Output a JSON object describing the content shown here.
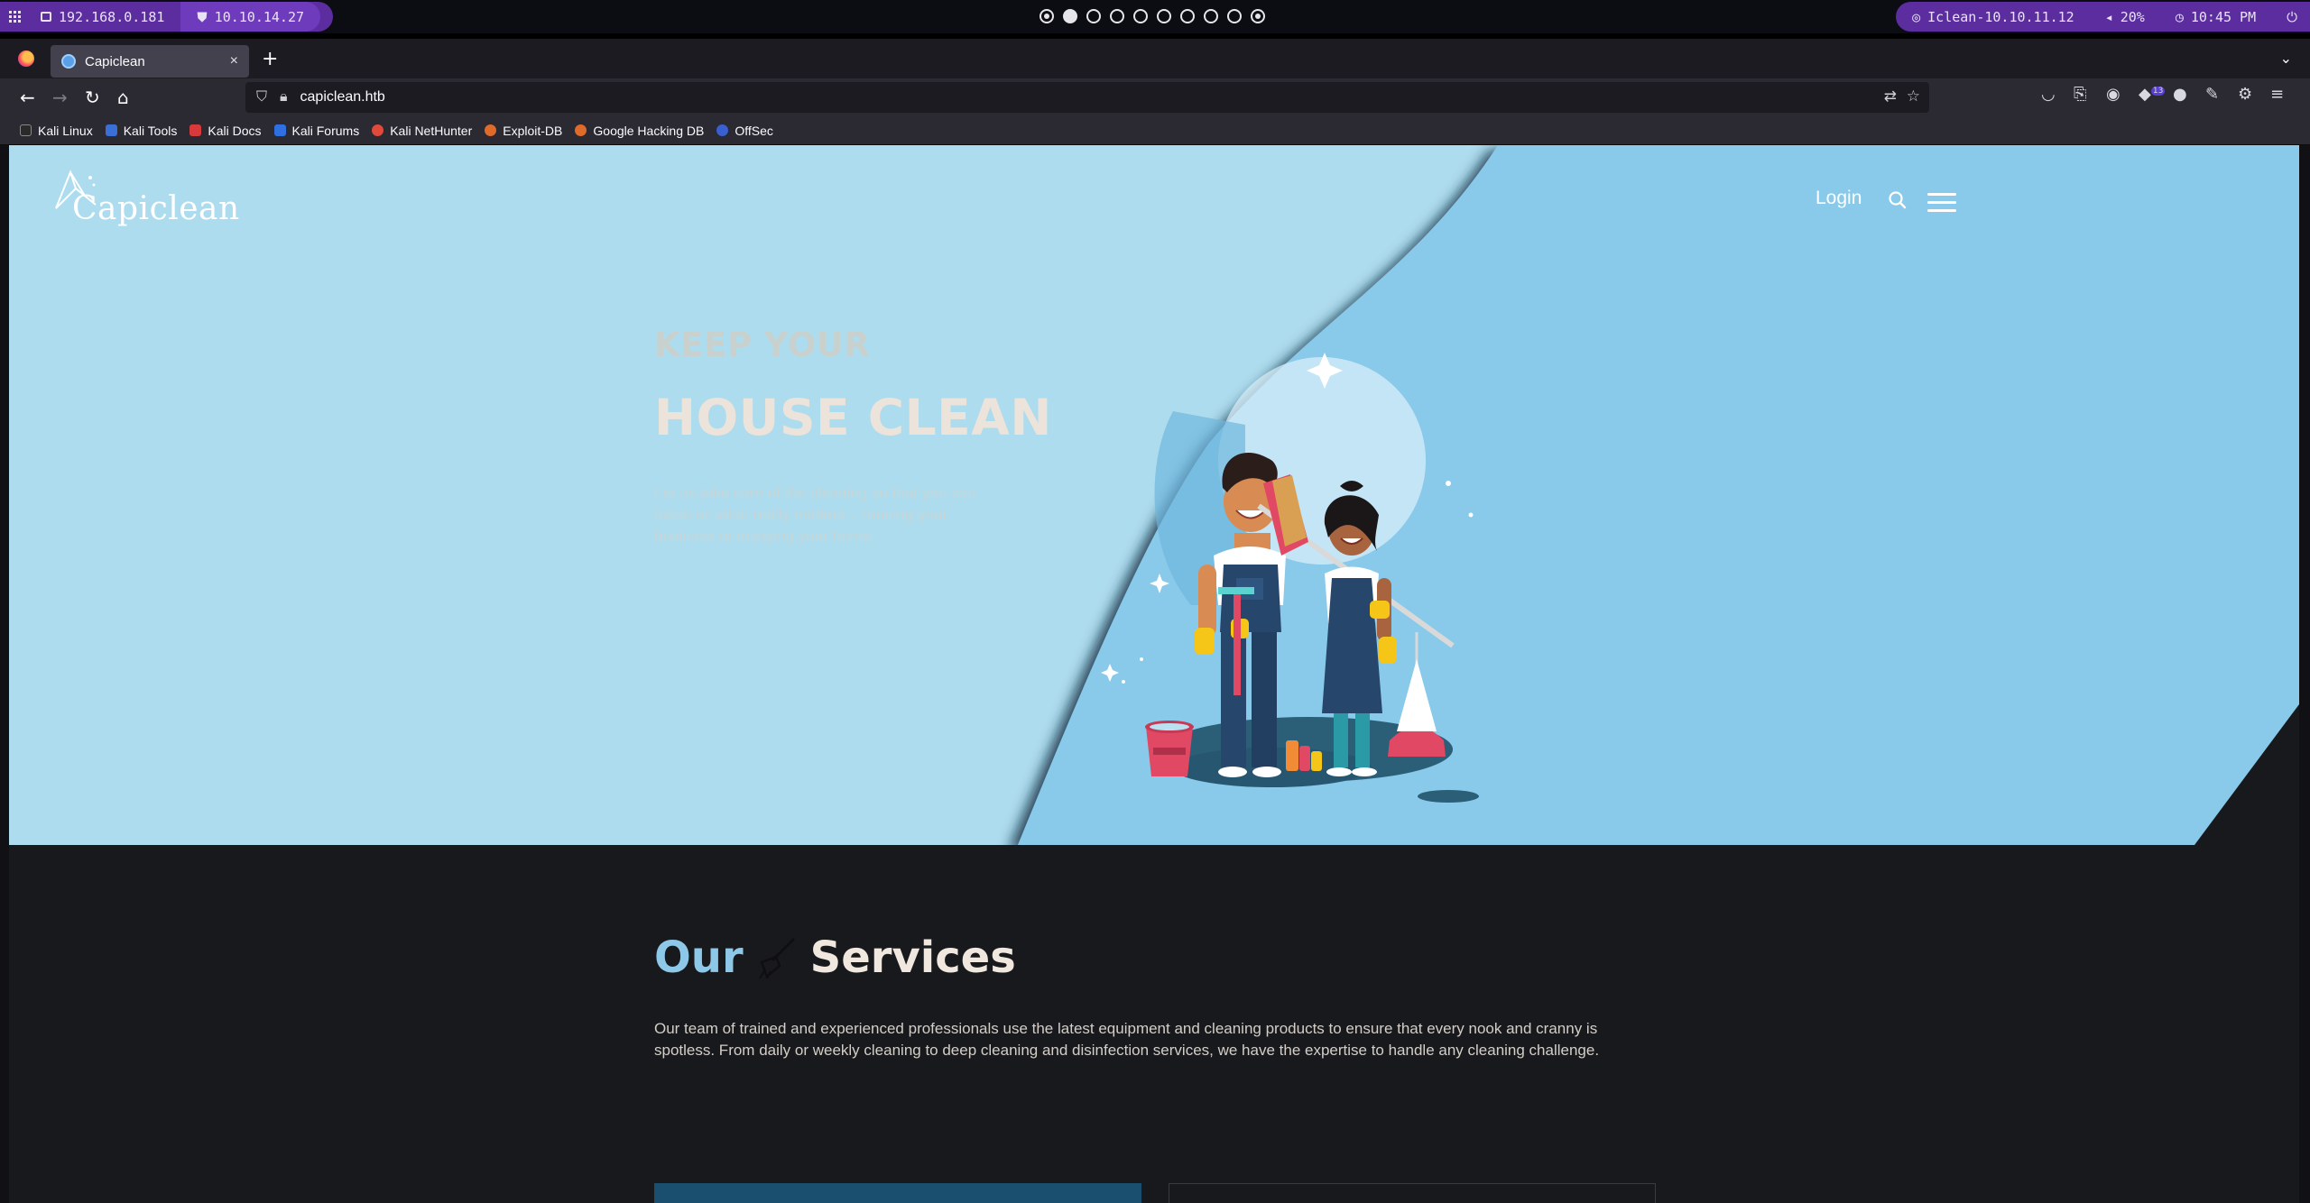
{
  "system_bar": {
    "local_ip": "192.168.0.181",
    "vpn_ip": "10.10.14.27",
    "target": "Iclean-10.10.11.12",
    "volume": "20%",
    "clock": "10:45 PM",
    "workspace_count": 10,
    "active_workspace": 2
  },
  "browser": {
    "tab_title": "Capiclean",
    "url": "capiclean.htb",
    "new_tab_label": "+",
    "close_tab_label": "×",
    "extension_badge": "13",
    "bookmarks": [
      {
        "label": "Kali Linux",
        "icon": "kali-icon",
        "color": "#2a2a2a"
      },
      {
        "label": "Kali Tools",
        "icon": "kali-tools-icon",
        "color": "#3a6fd8"
      },
      {
        "label": "Kali Docs",
        "icon": "kali-docs-icon",
        "color": "#d73a3a"
      },
      {
        "label": "Kali Forums",
        "icon": "kali-forums-icon",
        "color": "#2f6fe0"
      },
      {
        "label": "Kali NetHunter",
        "icon": "nethunter-icon",
        "color": "#e04a3a"
      },
      {
        "label": "Exploit-DB",
        "icon": "exploitdb-icon",
        "color": "#e06a2a"
      },
      {
        "label": "Google Hacking DB",
        "icon": "ghdb-icon",
        "color": "#e06a2a"
      },
      {
        "label": "OffSec",
        "icon": "offsec-icon",
        "color": "#3a5fd0"
      }
    ]
  },
  "site": {
    "brand": "Capiclean",
    "nav_login": "Login",
    "hero": {
      "kicker": "KEEP YOUR",
      "title": "HOUSE CLEAN",
      "subtitle": "Let us take care of the cleaning so that you can focus on what really matters – running your business or enjoying your home."
    },
    "services": {
      "title_a": "Our",
      "title_b": "Services",
      "body": "Our team of trained and experienced professionals use the latest equipment and cleaning products to ensure that every nook and cranny is spotless. From daily or weekly cleaning to deep cleaning and disinfection services, we have the expertise to handle any cleaning challenge."
    },
    "colors": {
      "hero_light": "#addcee",
      "hero_mid": "#89c9ea",
      "accent": "#8ec8e8",
      "dark_bg": "#18191c"
    }
  }
}
